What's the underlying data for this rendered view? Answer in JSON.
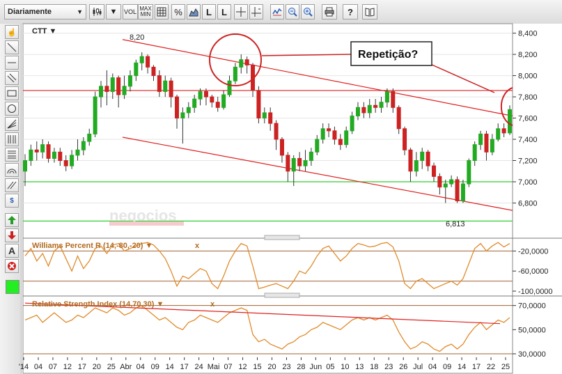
{
  "toolbar": {
    "period_select": "Diariamente",
    "vol_label": "VOL",
    "maxmin_label": "MAX MIN",
    "percent_label": "%",
    "line_label": "L",
    "help_label": "?"
  },
  "colors": {
    "up": "#22aa22",
    "down": "#cc2222",
    "line": "#e02020",
    "rsi": "#e08a2a",
    "williams": "#e08a2a",
    "green_line": "#33cc33",
    "brown_line": "#a06030"
  },
  "chart_data": [
    {
      "type": "candlestick",
      "title": "CTT ▼",
      "ylim": [
        6.58,
        8.45
      ],
      "yticks": [
        "8,400",
        "8,200",
        "8,000",
        "7,800",
        "7,600",
        "7,400",
        "7,200",
        "7,000",
        "6,800"
      ],
      "ytick_values": [
        8.4,
        8.2,
        8.0,
        7.8,
        7.6,
        7.4,
        7.2,
        7.0,
        6.8
      ],
      "x_labels": [
        "'14",
        "04",
        "07",
        "12",
        "17",
        "20",
        "25",
        "Abr",
        "04",
        "09",
        "14",
        "17",
        "24",
        "Mai",
        "07",
        "12",
        "15",
        "20",
        "23",
        "28",
        "Jun",
        "05",
        "10",
        "13",
        "18",
        "23",
        "26",
        "Jul",
        "04",
        "09",
        "14",
        "17",
        "22",
        "25"
      ],
      "annotations": {
        "high_label": "8,20",
        "low_label": "6,813",
        "callout": "Repetição?"
      },
      "candles": [
        [
          7.1,
          7.2,
          6.96,
          7.26
        ],
        [
          7.2,
          7.3,
          7.15,
          7.35
        ],
        [
          7.3,
          7.28,
          7.2,
          7.38
        ],
        [
          7.28,
          7.35,
          7.22,
          7.4
        ],
        [
          7.35,
          7.22,
          7.18,
          7.38
        ],
        [
          7.22,
          7.28,
          7.18,
          7.32
        ],
        [
          7.28,
          7.2,
          7.15,
          7.32
        ],
        [
          7.2,
          7.15,
          7.1,
          7.25
        ],
        [
          7.15,
          7.25,
          7.12,
          7.3
        ],
        [
          7.25,
          7.3,
          7.2,
          7.4
        ],
        [
          7.3,
          7.38,
          7.25,
          7.42
        ],
        [
          7.38,
          7.45,
          7.34,
          7.5
        ],
        [
          7.45,
          7.8,
          7.42,
          7.85
        ],
        [
          7.8,
          7.9,
          7.7,
          7.95
        ],
        [
          7.9,
          7.85,
          7.72,
          8.05
        ],
        [
          7.85,
          7.98,
          7.78,
          8.02
        ],
        [
          7.98,
          7.82,
          7.7,
          8.0
        ],
        [
          7.82,
          7.9,
          7.78,
          8.0
        ],
        [
          7.9,
          8.0,
          7.85,
          8.05
        ],
        [
          8.0,
          8.12,
          7.95,
          8.15
        ],
        [
          8.12,
          8.18,
          8.05,
          8.22
        ],
        [
          8.18,
          8.08,
          8.02,
          8.2
        ],
        [
          8.08,
          8.0,
          7.95,
          8.1
        ],
        [
          8.0,
          7.85,
          7.8,
          8.05
        ],
        [
          7.85,
          7.95,
          7.8,
          8.0
        ],
        [
          7.95,
          7.8,
          7.7,
          7.98
        ],
        [
          7.8,
          7.6,
          7.5,
          7.82
        ],
        [
          7.6,
          7.65,
          7.36,
          7.7
        ],
        [
          7.65,
          7.7,
          7.6,
          7.75
        ],
        [
          7.7,
          7.78,
          7.65,
          7.82
        ],
        [
          7.78,
          7.85,
          7.72,
          7.88
        ],
        [
          7.85,
          7.8,
          7.72,
          7.88
        ],
        [
          7.8,
          7.75,
          7.7,
          7.82
        ],
        [
          7.75,
          7.7,
          7.66,
          7.8
        ],
        [
          7.7,
          7.82,
          7.68,
          7.86
        ],
        [
          7.82,
          7.95,
          7.8,
          8.0
        ],
        [
          7.95,
          8.08,
          7.92,
          8.12
        ],
        [
          8.08,
          8.15,
          8.02,
          8.2
        ],
        [
          8.15,
          8.1,
          8.02,
          8.18
        ],
        [
          8.1,
          7.86,
          7.8,
          8.12
        ],
        [
          7.86,
          7.6,
          7.55,
          7.9
        ],
        [
          7.6,
          7.65,
          7.55,
          7.7
        ],
        [
          7.65,
          7.55,
          7.48,
          7.7
        ],
        [
          7.55,
          7.4,
          7.3,
          7.58
        ],
        [
          7.4,
          7.25,
          7.18,
          7.42
        ],
        [
          7.25,
          7.1,
          7.0,
          7.28
        ],
        [
          7.1,
          7.22,
          6.96,
          7.25
        ],
        [
          7.22,
          7.15,
          7.1,
          7.28
        ],
        [
          7.15,
          7.2,
          7.1,
          7.3
        ],
        [
          7.2,
          7.28,
          7.15,
          7.32
        ],
        [
          7.28,
          7.4,
          7.25,
          7.44
        ],
        [
          7.4,
          7.5,
          7.36,
          7.55
        ],
        [
          7.5,
          7.48,
          7.42,
          7.55
        ],
        [
          7.48,
          7.4,
          7.35,
          7.52
        ],
        [
          7.4,
          7.35,
          7.3,
          7.45
        ],
        [
          7.35,
          7.48,
          7.32,
          7.52
        ],
        [
          7.48,
          7.62,
          7.45,
          7.66
        ],
        [
          7.62,
          7.7,
          7.58,
          7.75
        ],
        [
          7.7,
          7.65,
          7.6,
          7.75
        ],
        [
          7.65,
          7.72,
          7.6,
          7.78
        ],
        [
          7.72,
          7.7,
          7.65,
          7.78
        ],
        [
          7.7,
          7.75,
          7.65,
          7.8
        ],
        [
          7.75,
          7.85,
          7.7,
          7.88
        ],
        [
          7.85,
          7.7,
          7.65,
          7.88
        ],
        [
          7.7,
          7.5,
          7.45,
          7.72
        ],
        [
          7.5,
          7.3,
          7.25,
          7.52
        ],
        [
          7.3,
          7.1,
          7.0,
          7.32
        ],
        [
          7.1,
          7.2,
          7.05,
          7.28
        ],
        [
          7.2,
          7.28,
          7.12,
          7.32
        ],
        [
          7.28,
          7.15,
          7.1,
          7.3
        ],
        [
          7.15,
          7.05,
          7.0,
          7.18
        ],
        [
          7.05,
          6.95,
          6.88,
          7.08
        ],
        [
          6.95,
          6.98,
          6.8,
          7.02
        ],
        [
          6.98,
          7.02,
          6.95,
          7.06
        ],
        [
          7.02,
          6.82,
          6.8,
          7.05
        ],
        [
          6.82,
          6.98,
          6.8,
          7.02
        ],
        [
          6.98,
          7.2,
          6.95,
          7.22
        ],
        [
          7.2,
          7.35,
          7.15,
          7.38
        ],
        [
          7.35,
          7.45,
          7.3,
          7.48
        ],
        [
          7.45,
          7.28,
          7.2,
          7.48
        ],
        [
          7.28,
          7.4,
          7.25,
          7.45
        ],
        [
          7.4,
          7.5,
          7.38,
          7.55
        ],
        [
          7.5,
          7.46,
          7.42,
          7.55
        ],
        [
          7.46,
          7.68,
          7.44,
          7.72
        ]
      ]
    },
    {
      "type": "line",
      "title": "Williams Percent R (14,-80,-20) ▼",
      "close_label": "x",
      "ylim": [
        -100,
        0
      ],
      "yticks": [
        "-20,0000",
        "-60,0000",
        "-100,0000"
      ],
      "ytick_values": [
        -20,
        -60,
        -100
      ],
      "levels": [
        -20,
        -80
      ],
      "series": [
        {
          "values": [
            -30,
            -15,
            -40,
            -25,
            -50,
            -20,
            -10,
            -35,
            -60,
            -30,
            -55,
            -40,
            -15,
            -10,
            -25,
            -8,
            -5,
            -20,
            -15,
            -10,
            -5,
            -3,
            -8,
            -20,
            -35,
            -60,
            -90,
            -70,
            -75,
            -65,
            -55,
            -60,
            -85,
            -95,
            -70,
            -40,
            -20,
            -5,
            -10,
            -50,
            -95,
            -92,
            -88,
            -85,
            -90,
            -95,
            -80,
            -60,
            -65,
            -50,
            -30,
            -15,
            -10,
            -25,
            -40,
            -30,
            -15,
            -5,
            -8,
            -12,
            -10,
            -5,
            -3,
            -12,
            -40,
            -85,
            -95,
            -80,
            -75,
            -85,
            -95,
            -90,
            -85,
            -80,
            -88,
            -75,
            -45,
            -15,
            -5,
            -20,
            -10,
            -3,
            -12,
            -5
          ]
        }
      ]
    },
    {
      "type": "line",
      "title": "Relative Strength Index (14,70,30) ▼",
      "close_label": "x",
      "ylim": [
        30,
        75
      ],
      "yticks": [
        "70,0000",
        "50,0000",
        "30,0000"
      ],
      "ytick_values": [
        70,
        50,
        30
      ],
      "levels": [
        70,
        30
      ],
      "series": [
        {
          "values": [
            58,
            60,
            62,
            56,
            60,
            64,
            60,
            56,
            58,
            62,
            60,
            64,
            68,
            66,
            64,
            68,
            66,
            62,
            64,
            68,
            70,
            66,
            62,
            58,
            60,
            56,
            52,
            50,
            56,
            58,
            62,
            60,
            58,
            56,
            60,
            64,
            66,
            68,
            66,
            46,
            40,
            42,
            38,
            36,
            34,
            38,
            40,
            44,
            46,
            50,
            52,
            56,
            54,
            52,
            50,
            54,
            58,
            60,
            58,
            60,
            58,
            60,
            62,
            58,
            48,
            40,
            34,
            36,
            40,
            38,
            34,
            32,
            36,
            38,
            34,
            38,
            46,
            52,
            56,
            50,
            54,
            58,
            56,
            60
          ]
        }
      ]
    }
  ]
}
